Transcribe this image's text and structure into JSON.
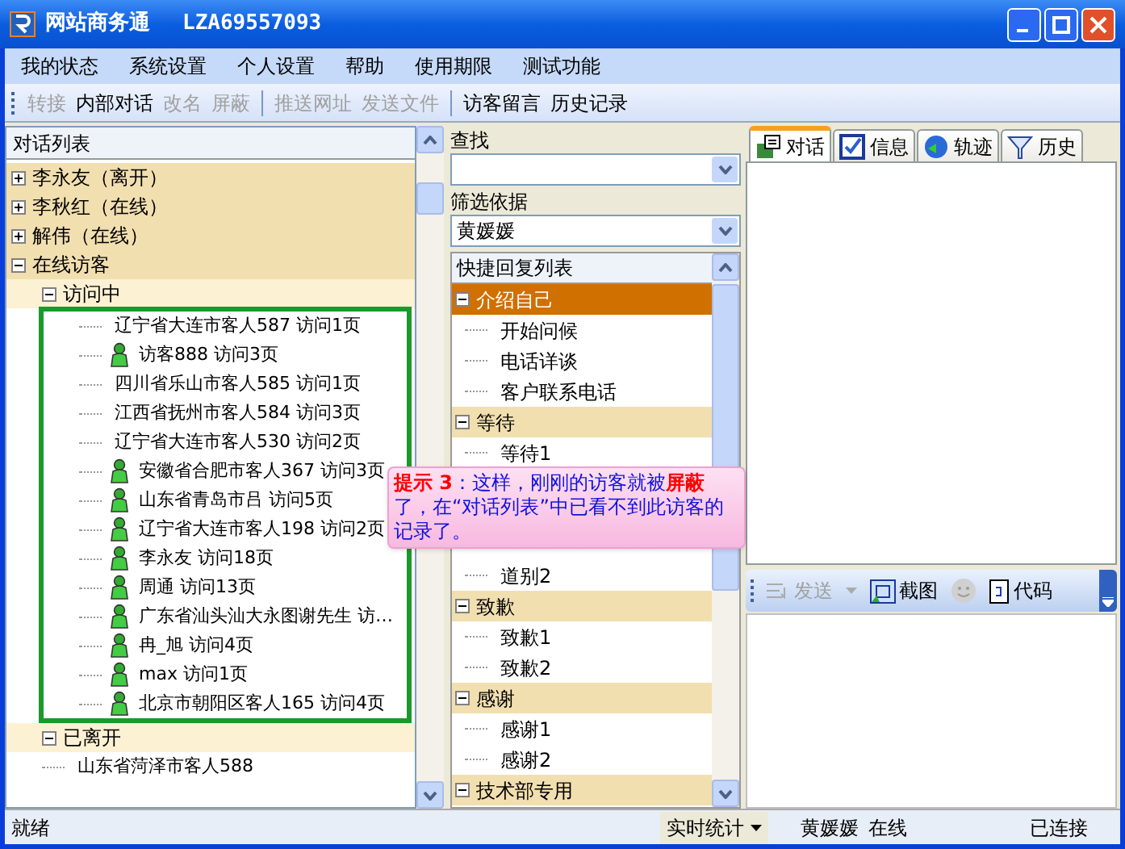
{
  "window": {
    "title": "网站商务通",
    "account": "LZA69557093"
  },
  "menu": [
    "我的状态",
    "系统设置",
    "个人设置",
    "帮助",
    "使用期限",
    "测试功能"
  ],
  "toolbar": [
    [
      {
        "label": "转接",
        "disabled": true
      },
      {
        "label": "内部对话",
        "disabled": false
      },
      {
        "label": "改名",
        "disabled": true
      },
      {
        "label": "屏蔽",
        "disabled": true
      }
    ],
    [
      {
        "label": "推送网址",
        "disabled": true
      },
      {
        "label": "发送文件",
        "disabled": true
      }
    ],
    [
      {
        "label": "访客留言",
        "disabled": false
      },
      {
        "label": "历史记录",
        "disabled": false
      }
    ]
  ],
  "conversation_list": {
    "header": "对话列表",
    "tree": [
      {
        "label": "李永友（离开）",
        "expanded": false
      },
      {
        "label": "李秋红（在线）",
        "expanded": false
      },
      {
        "label": "解伟（在线）",
        "expanded": false
      },
      {
        "label": "在线访客",
        "expanded": true,
        "children": [
          {
            "label": "访问中",
            "expanded": true,
            "outlined": true,
            "children": [
              {
                "label": "辽宁省大连市客人587  访问1页",
                "kind": "plain"
              },
              {
                "label": "访客888  访问3页",
                "kind": "person"
              },
              {
                "label": "四川省乐山市客人585  访问1页",
                "kind": "plain"
              },
              {
                "label": "江西省抚州市客人584  访问3页",
                "kind": "plain"
              },
              {
                "label": "辽宁省大连市客人530  访问2页",
                "kind": "plain"
              },
              {
                "label": "安徽省合肥市客人367  访问3页",
                "kind": "person"
              },
              {
                "label": "山东省青岛市吕  访问5页",
                "kind": "person"
              },
              {
                "label": "辽宁省大连市客人198  访问2页",
                "kind": "person"
              },
              {
                "label": "李永友  访问18页",
                "kind": "person"
              },
              {
                "label": "周通  访问13页",
                "kind": "person"
              },
              {
                "label": "广东省汕头汕大永图谢先生  访…",
                "kind": "person"
              },
              {
                "label": "冉_旭  访问4页",
                "kind": "person"
              },
              {
                "label": "max  访问1页",
                "kind": "person"
              },
              {
                "label": "北京市朝阳区客人165  访问4页",
                "kind": "person"
              }
            ]
          },
          {
            "label": "已离开",
            "expanded": true,
            "outlined": false,
            "children": [
              {
                "label": "山东省菏泽市客人588",
                "kind": "plain"
              }
            ]
          }
        ]
      }
    ]
  },
  "search": {
    "label": "查找"
  },
  "filter": {
    "label": "筛选依据",
    "value": "黄媛媛"
  },
  "quick_replies": {
    "header": "快捷回复列表",
    "rows": [
      {
        "kind": "group",
        "label": "介绍自己",
        "selected": true
      },
      {
        "kind": "item",
        "label": "开始问候"
      },
      {
        "kind": "item",
        "label": "电话详谈"
      },
      {
        "kind": "item",
        "label": "客户联系电话"
      },
      {
        "kind": "group",
        "label": "等待",
        "selected": false
      },
      {
        "kind": "item",
        "label": "等待1"
      },
      {
        "kind": "covered"
      },
      {
        "kind": "covered"
      },
      {
        "kind": "covered"
      },
      {
        "kind": "item",
        "label": "道别2"
      },
      {
        "kind": "group",
        "label": "致歉",
        "selected": false
      },
      {
        "kind": "item",
        "label": "致歉1"
      },
      {
        "kind": "item",
        "label": "致歉2"
      },
      {
        "kind": "group",
        "label": "感谢",
        "selected": false
      },
      {
        "kind": "item",
        "label": "感谢1"
      },
      {
        "kind": "item",
        "label": "感谢2"
      },
      {
        "kind": "group",
        "label": "技术部专用",
        "selected": false
      }
    ]
  },
  "tooltip": {
    "text": "**提示 3**：这样，刚刚的访客就被**屏蔽**了，在“对话列表”中已看不到此访客的记录了。"
  },
  "tabs": [
    {
      "label": "对话",
      "kind": "chat",
      "selected": true
    },
    {
      "label": "信息",
      "kind": "info",
      "selected": false
    },
    {
      "label": "轨迹",
      "kind": "track",
      "selected": false
    },
    {
      "label": "历史",
      "kind": "history",
      "selected": false
    }
  ],
  "chat_toolbar": [
    {
      "kind": "send",
      "label": "发送",
      "disabled": true
    },
    {
      "kind": "screenshot",
      "label": "截图",
      "disabled": false
    },
    {
      "kind": "emoji",
      "disabled": true
    },
    {
      "kind": "code",
      "label": "代码",
      "disabled": false
    }
  ],
  "status_bar": {
    "message": "就绪",
    "stats_button": "实时统计",
    "user": "黄媛媛",
    "presence": "在线",
    "connection": "已连接"
  }
}
